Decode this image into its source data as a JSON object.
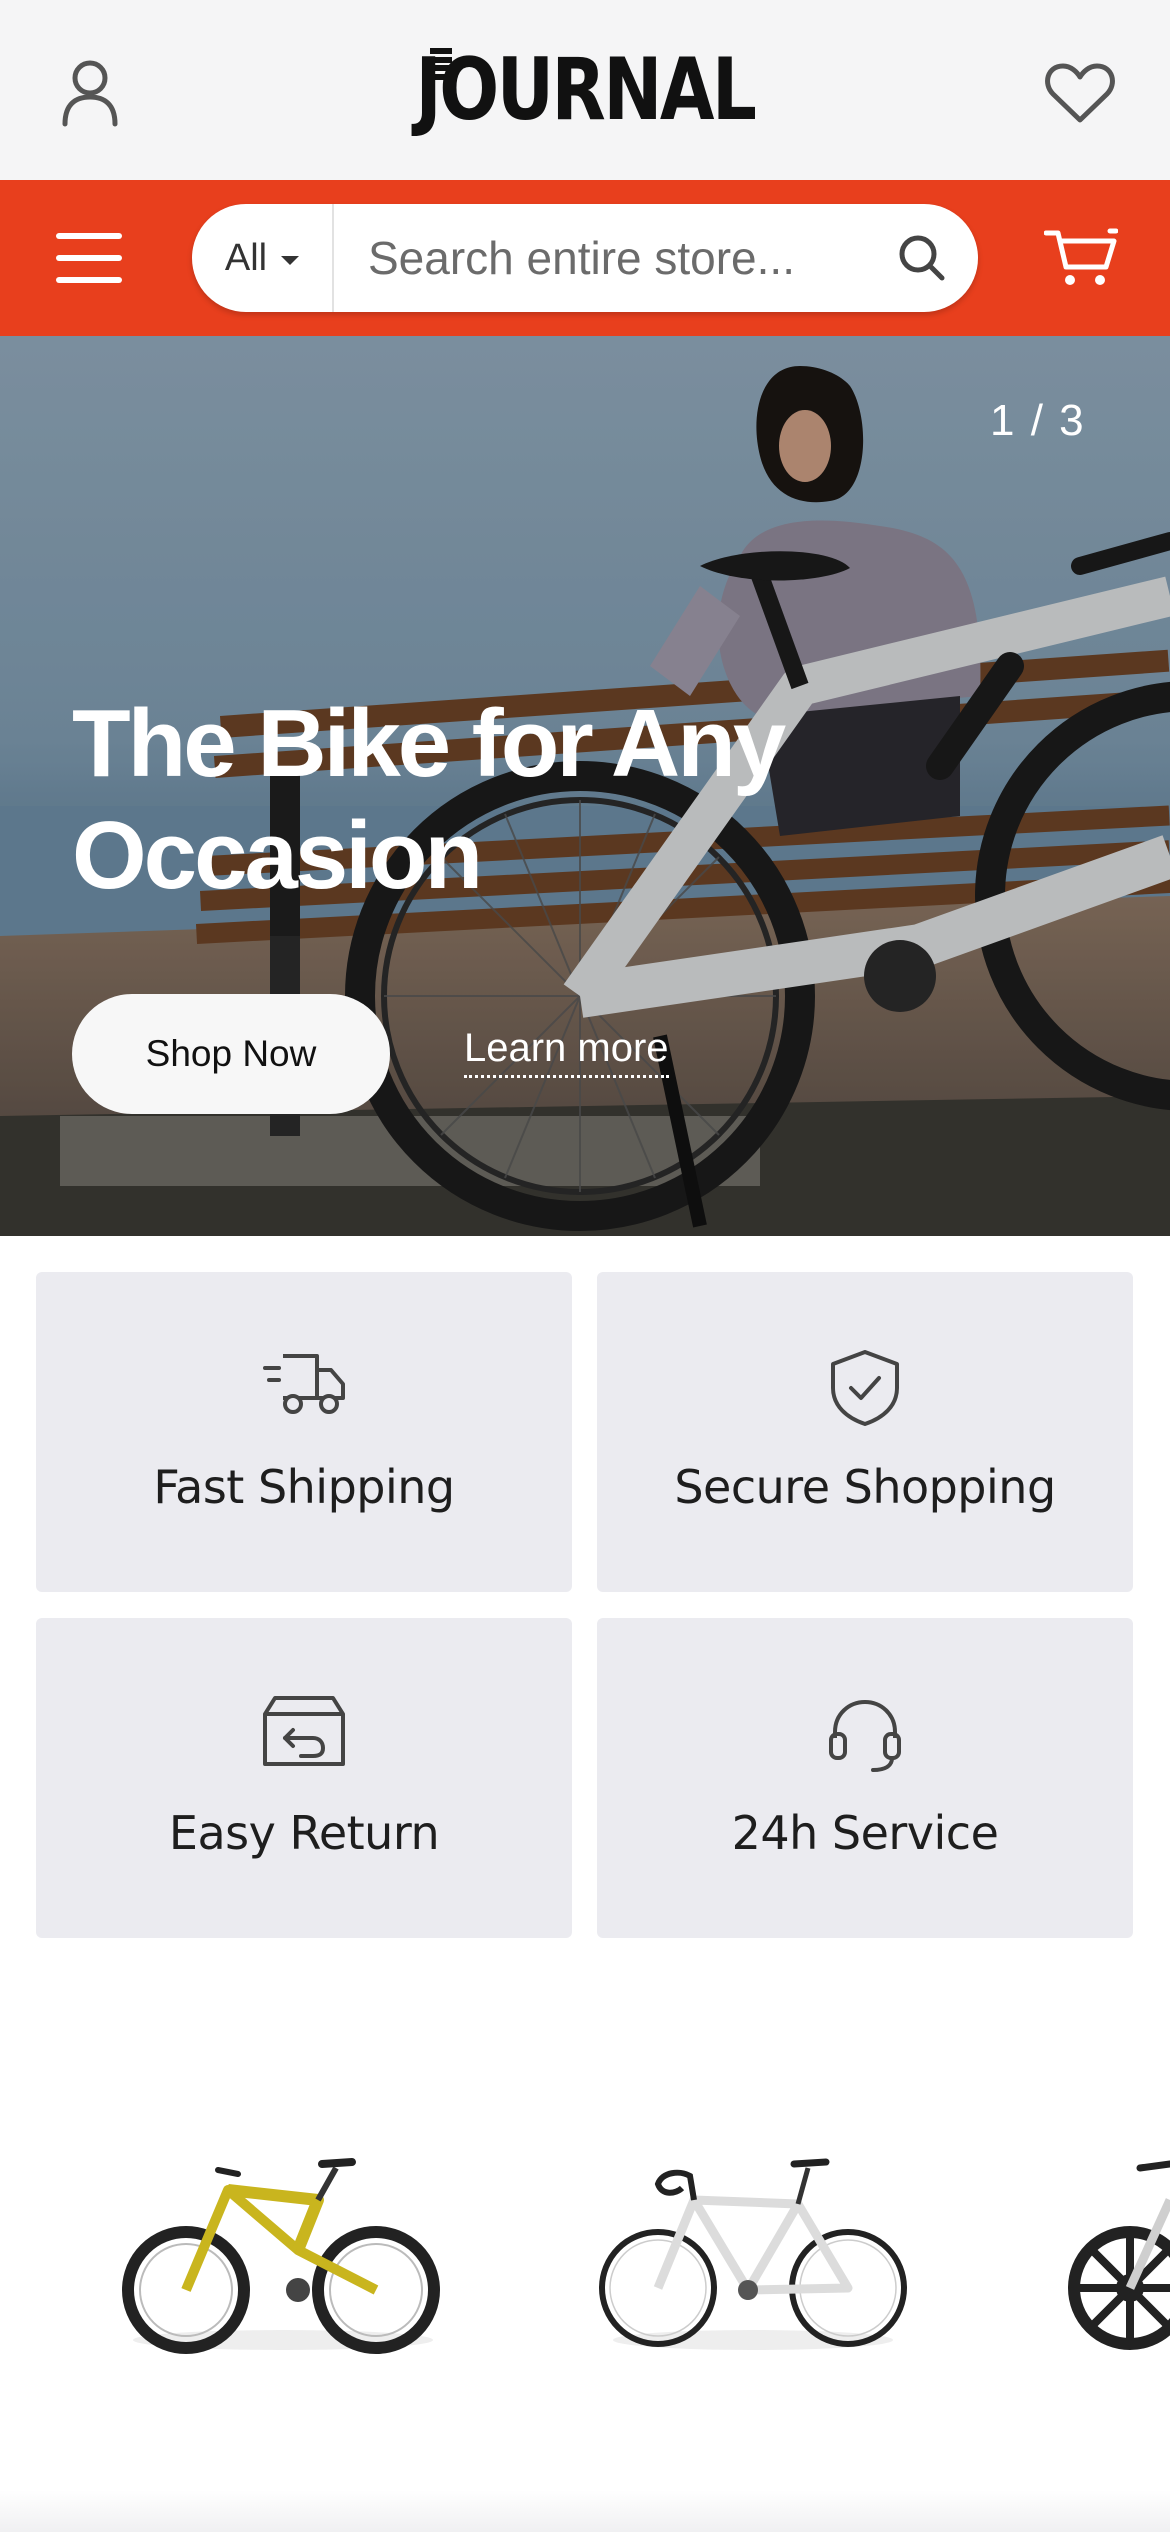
{
  "header": {
    "logo_text": "JOURNAL",
    "account_icon": "user-icon",
    "wishlist_icon": "heart-icon"
  },
  "nav": {
    "menu_icon": "hamburger-icon",
    "search_category": "All",
    "search_placeholder": "Search entire store...",
    "search_icon": "search-icon",
    "cart_icon": "cart-icon",
    "accent_color": "#e83f1d"
  },
  "hero": {
    "counter": "1 / 3",
    "title": "The Bike for Any Occasion",
    "primary_cta": "Shop Now",
    "secondary_cta": "Learn more"
  },
  "features": [
    {
      "label": "Fast Shipping",
      "icon": "truck-icon"
    },
    {
      "label": "Secure Shopping",
      "icon": "shield-check-icon"
    },
    {
      "label": "Easy Return",
      "icon": "return-box-icon"
    },
    {
      "label": "24h Service",
      "icon": "headset-icon"
    }
  ],
  "products": [
    {
      "icon": "mountain-bike-image",
      "color": "#c9b51e"
    },
    {
      "icon": "road-bike-image",
      "color": "#e2e2e2"
    },
    {
      "icon": "bike-image-partial",
      "color": "#222222"
    }
  ]
}
